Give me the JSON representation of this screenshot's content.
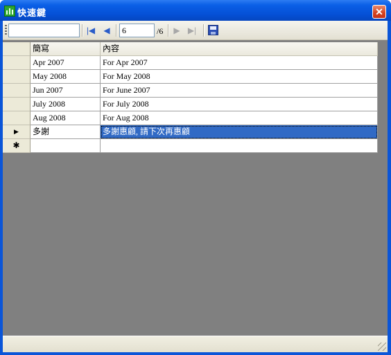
{
  "window": {
    "title": "快速鍵"
  },
  "toolbar": {
    "search_value": "",
    "position_value": "6",
    "count_text": "/6"
  },
  "grid": {
    "columns": [
      "簡寫",
      "內容"
    ],
    "rows": [
      {
        "abbr": "Apr 2007",
        "content": "For Apr 2007",
        "marker": ""
      },
      {
        "abbr": "May 2008",
        "content": "For May 2008",
        "marker": ""
      },
      {
        "abbr": "Jun 2007",
        "content": "For June 2007",
        "marker": ""
      },
      {
        "abbr": "July 2008",
        "content": "For July 2008",
        "marker": ""
      },
      {
        "abbr": "Aug 2008",
        "content": "For Aug 2008",
        "marker": ""
      },
      {
        "abbr": "多謝",
        "content": "多謝惠顧, 請下次再惠顧",
        "marker": "▶"
      },
      {
        "abbr": "",
        "content": "",
        "marker": "✱"
      }
    ]
  },
  "icons": {
    "first": "move-first-icon",
    "prev": "move-previous-icon",
    "next": "move-next-icon",
    "last": "move-last-icon",
    "save": "save-icon",
    "close": "close-icon"
  },
  "colors": {
    "selection": "#316ac5",
    "title_bar": "#0a5fe6",
    "grid_background": "#808080"
  }
}
